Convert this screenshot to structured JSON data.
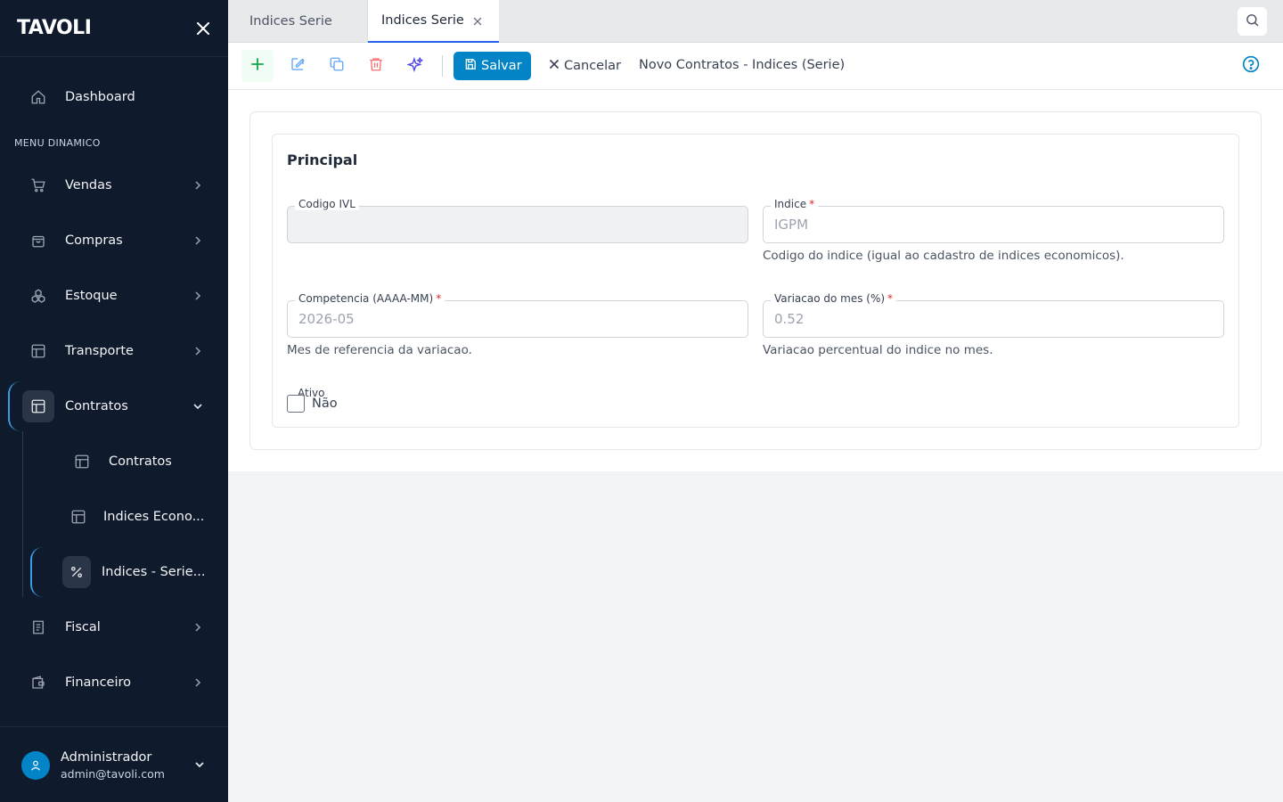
{
  "app": {
    "logo": "TAVOLI"
  },
  "sidebar": {
    "dashboard": "Dashboard",
    "section_label": "MENU DINAMICO",
    "items": [
      {
        "label": "Vendas"
      },
      {
        "label": "Compras"
      },
      {
        "label": "Estoque"
      },
      {
        "label": "Transporte"
      },
      {
        "label": "Contratos"
      },
      {
        "label": "Fiscal"
      },
      {
        "label": "Financeiro"
      }
    ],
    "sub_items": [
      {
        "label": "Contratos"
      },
      {
        "label": "Indices Econo..."
      },
      {
        "label": "Indices - Serie..."
      }
    ]
  },
  "user": {
    "name": "Administrador",
    "email": "admin@tavoli.com"
  },
  "tabs": [
    {
      "label": "Indices Serie"
    },
    {
      "label": "Indices Serie"
    }
  ],
  "toolbar": {
    "save_label": "Salvar",
    "cancel_label": "Cancelar",
    "form_title": "Novo Contratos - Indices (Serie)"
  },
  "form": {
    "section_title": "Principal",
    "codigo_ivl": {
      "label": "Codigo IVL",
      "value": ""
    },
    "indice": {
      "label": "Indice",
      "required": "*",
      "placeholder": "IGPM",
      "help": "Codigo do indice (igual ao cadastro de indices economicos)."
    },
    "competencia": {
      "label": "Competencia (AAAA-MM)",
      "required": "*",
      "placeholder": "2026-05",
      "help": "Mes de referencia da variacao."
    },
    "variacao": {
      "label": "Variacao do mes (%)",
      "required": "*",
      "placeholder": "0.52",
      "help": "Variacao percentual do indice no mes."
    },
    "ativo": {
      "label": "Ativo",
      "value_text": "Não"
    }
  },
  "colors": {
    "sidebar_bg": "#0f1b2d",
    "primary": "#0284c7",
    "active_bracket": "#3b9be0",
    "tab_underline": "#2563eb",
    "add_green": "#16a34a",
    "edit_blue": "#60a5fa",
    "delete_red": "#f87171",
    "magic_indigo": "#4f46e5",
    "required_red": "#dc2626"
  }
}
